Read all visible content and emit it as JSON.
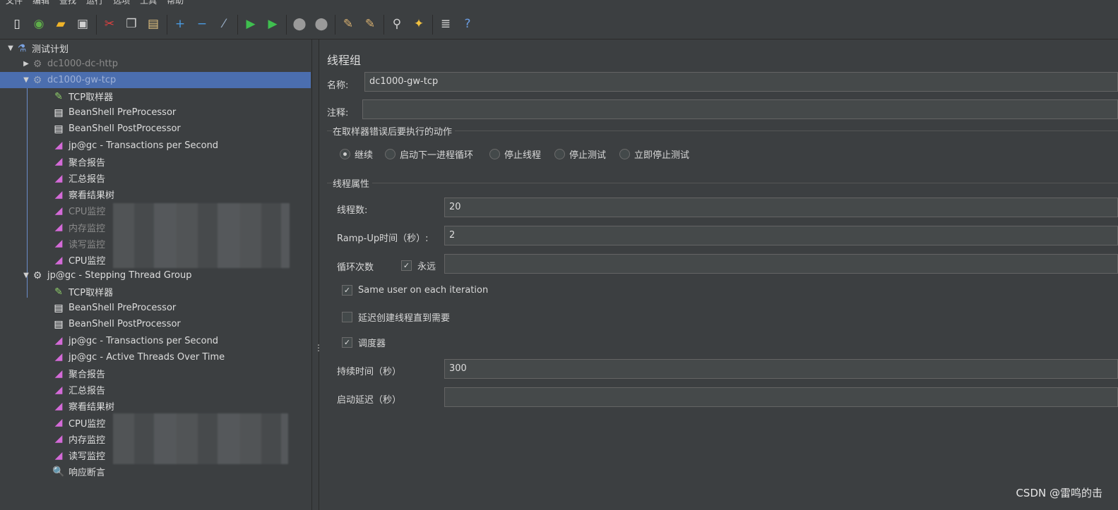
{
  "menu": [
    "文件",
    "编辑",
    "查找",
    "运行",
    "选项",
    "工具",
    "帮助"
  ],
  "toolbar": [
    {
      "icon": "new-icon",
      "glyph": "▯",
      "color": "#e8e8e8"
    },
    {
      "icon": "templates-icon",
      "glyph": "◉",
      "color": "#5fae4a"
    },
    {
      "icon": "open-icon",
      "glyph": "▰",
      "color": "#f0b429"
    },
    {
      "icon": "save-icon",
      "glyph": "▣",
      "color": "#d0d0d0"
    },
    {
      "icon": "cut-icon",
      "glyph": "✂",
      "color": "#e04040"
    },
    {
      "icon": "copy-icon",
      "glyph": "❐",
      "color": "#d0d0d0"
    },
    {
      "icon": "paste-icon",
      "glyph": "▤",
      "color": "#e0c080"
    },
    {
      "icon": "expand-icon",
      "glyph": "+",
      "color": "#4a9be0"
    },
    {
      "icon": "collapse-icon",
      "glyph": "−",
      "color": "#4a9be0"
    },
    {
      "icon": "toggle-icon",
      "glyph": "⁄",
      "color": "#9ab0c8"
    },
    {
      "icon": "start-icon",
      "glyph": "▶",
      "color": "#3fbf4f"
    },
    {
      "icon": "start-no-pause-icon",
      "glyph": "▶",
      "color": "#3fbf4f"
    },
    {
      "icon": "stop-icon",
      "glyph": "⬤",
      "color": "#9a9a9a"
    },
    {
      "icon": "shutdown-icon",
      "glyph": "⬤",
      "color": "#9a9a9a"
    },
    {
      "icon": "clear-icon",
      "glyph": "✎",
      "color": "#d8b070"
    },
    {
      "icon": "clear-all-icon",
      "glyph": "✎",
      "color": "#d8b070"
    },
    {
      "icon": "search-icon",
      "glyph": "⚲",
      "color": "#d0d0d0"
    },
    {
      "icon": "reset-search-icon",
      "glyph": "✦",
      "color": "#f0c040"
    },
    {
      "icon": "function-helper-icon",
      "glyph": "≣",
      "color": "#d0d0d0"
    },
    {
      "icon": "help-icon",
      "glyph": "?",
      "color": "#6a9ce0"
    }
  ],
  "tree": {
    "test_plan": "测试计划",
    "items": [
      {
        "label": "dc1000-dc-http",
        "dim": true
      },
      {
        "label": "dc1000-gw-tcp",
        "dim": true
      },
      {
        "label": "TCP取样器"
      },
      {
        "label": "BeanShell PreProcessor"
      },
      {
        "label": "BeanShell PostProcessor"
      },
      {
        "label": "jp@gc - Transactions per Second"
      },
      {
        "label": "聚合报告"
      },
      {
        "label": "汇总报告"
      },
      {
        "label": "察看结果树"
      },
      {
        "label": "CPU监控",
        "dim": true
      },
      {
        "label": "内存监控",
        "dim": true
      },
      {
        "label": "读写监控",
        "dim": true
      },
      {
        "label": "CPU监控"
      },
      {
        "label": "jp@gc - Stepping Thread Group"
      },
      {
        "label": "TCP取样器"
      },
      {
        "label": "BeanShell PreProcessor"
      },
      {
        "label": "BeanShell PostProcessor"
      },
      {
        "label": "jp@gc - Transactions per Second"
      },
      {
        "label": "jp@gc - Active Threads Over Time"
      },
      {
        "label": "聚合报告"
      },
      {
        "label": "汇总报告"
      },
      {
        "label": "察看结果树"
      },
      {
        "label": "CPU监控"
      },
      {
        "label": "内存监控"
      },
      {
        "label": "读写监控"
      },
      {
        "label": "响应断言"
      }
    ]
  },
  "form": {
    "title": "线程组",
    "name_label": "名称:",
    "name_value": "dc1000-gw-tcp",
    "comment_label": "注释:",
    "comment_value": "",
    "error_group_title": "在取样器错误后要执行的动作",
    "error_actions": [
      {
        "label": "继续",
        "selected": true
      },
      {
        "label": "启动下一进程循环",
        "selected": false
      },
      {
        "label": "停止线程",
        "selected": false
      },
      {
        "label": "停止测试",
        "selected": false
      },
      {
        "label": "立即停止测试",
        "selected": false
      }
    ],
    "props_group_title": "线程属性",
    "threads_label": "线程数:",
    "threads_value": "20",
    "rampup_label": "Ramp-Up时间（秒）:",
    "rampup_value": "2",
    "loop_label": "循环次数",
    "loop_forever_label": "永远",
    "loop_forever_checked": true,
    "loop_value": "",
    "same_user_label": "Same user on each iteration",
    "same_user_checked": true,
    "delay_create_label": "延迟创建线程直到需要",
    "delay_create_checked": false,
    "scheduler_label": "调度器",
    "scheduler_checked": true,
    "duration_label": "持续时间（秒）",
    "duration_value": "300",
    "startup_delay_label": "启动延迟（秒）",
    "startup_delay_value": ""
  },
  "watermark": "CSDN @雷鸣的击"
}
